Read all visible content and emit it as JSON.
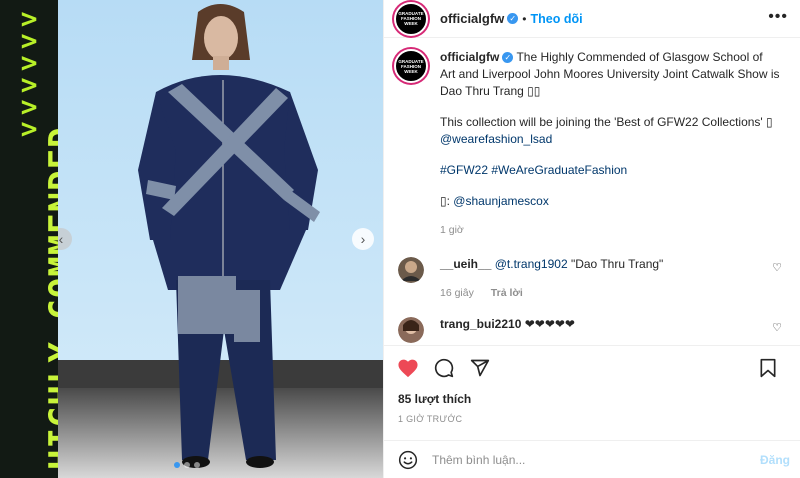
{
  "banner": {
    "chevrons": [
      ">",
      ">",
      ">",
      ">",
      ">",
      ">"
    ],
    "text": "HIGHLY COMMENDED",
    "accent_color": "#c8f43a"
  },
  "photo": {
    "carousel_prev": "‹",
    "carousel_next": "›",
    "dots": [
      true,
      false,
      false
    ]
  },
  "header": {
    "avatar_logo": "GRADUATE FASHION WEEK",
    "username": "officialgfw",
    "verified_glyph": "✓",
    "separator": "•",
    "follow_label": "Theo dõi",
    "more_icon": "•••"
  },
  "caption": {
    "username": "officialgfw",
    "text1": " The Highly Commended of Glasgow School of Art and Liverpool John Moores University Joint Catwalk Show is Dao Thru Trang ",
    "emoji_placeholder": "▯▯",
    "text2": "This collection will be joining the 'Best of GFW22 Collections' ▯",
    "mention1": "@wearefashion_lsad",
    "hashtags": "#GFW22 #WeAreGraduateFashion",
    "credit_prefix": "▯: ",
    "mention2": "@shaunjamescox",
    "time": "1 giờ"
  },
  "comments": [
    {
      "username": "__ueih__",
      "mention": "@t.trang1902",
      "text": " \"Dao Thru Trang\"",
      "time": "16 giây",
      "reply": "Trả lời"
    },
    {
      "username": "trang_bui2210",
      "text": " ❤❤❤❤❤"
    }
  ],
  "likes": "85 lượt thích",
  "timestamp": "1 GIỜ TRƯỚC",
  "add_comment": {
    "placeholder": "Thêm bình luận...",
    "post_label": "Đăng"
  },
  "colors": {
    "like_red": "#ed4956",
    "link_blue": "#0095f6",
    "verified_blue": "#3897f0"
  }
}
